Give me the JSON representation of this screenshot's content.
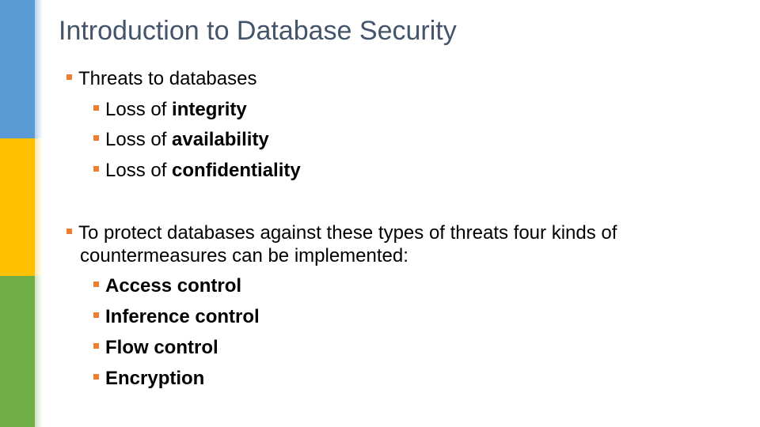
{
  "slide": {
    "title": "Introduction to Database Security",
    "colors": {
      "bar_blue": "#5b9bd5",
      "bar_yellow": "#ffc000",
      "bar_green": "#70ad47",
      "bullet": "#ed7d31",
      "title": "#44546a"
    },
    "sections": [
      {
        "text": "Threats to databases",
        "items": [
          {
            "prefix": "Loss of ",
            "emphasis": "integrity"
          },
          {
            "prefix": "Loss of ",
            "emphasis": "availability"
          },
          {
            "prefix": "Loss of ",
            "emphasis": "confidentiality"
          }
        ]
      },
      {
        "text_line1": "To protect databases against these types of threats four kinds of",
        "text_line2": "countermeasures can be implemented:",
        "items": [
          {
            "emphasis": "Access control"
          },
          {
            "emphasis": "Inference control"
          },
          {
            "emphasis": "Flow control"
          },
          {
            "emphasis": "Encryption"
          }
        ]
      }
    ]
  }
}
